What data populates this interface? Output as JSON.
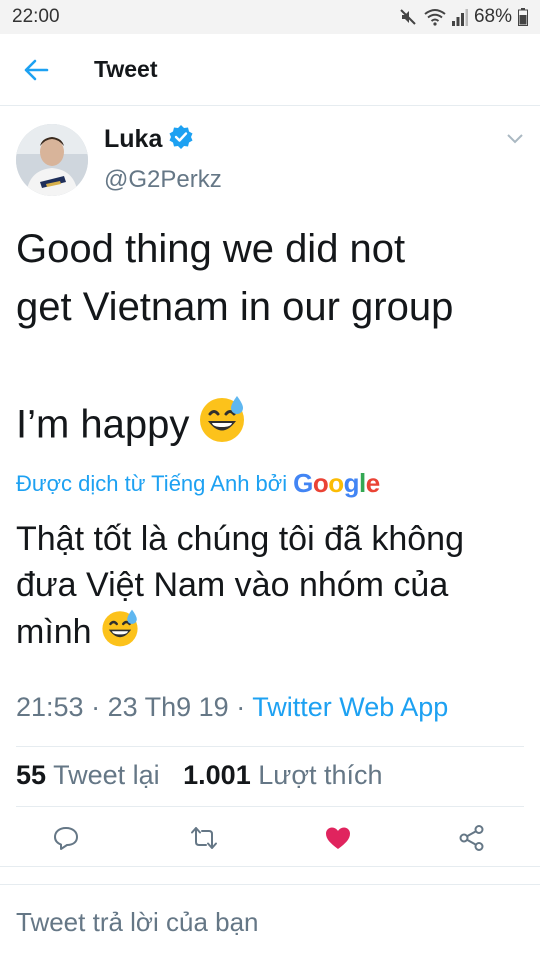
{
  "status_bar": {
    "time": "22:00",
    "battery": "68%",
    "icons": [
      "mute-icon",
      "wifi-icon",
      "signal-icon",
      "battery-icon"
    ]
  },
  "header": {
    "title": "Tweet",
    "back_icon": "back-arrow-icon"
  },
  "tweet": {
    "author_name": "Luka",
    "verified": true,
    "handle": "@G2Perkz",
    "text_lines": [
      "Good thing we did not",
      "get Vietnam in our group",
      "",
      "I’m happy"
    ],
    "emoji": "sweat-smile-emoji",
    "translated_by": "Được dịch từ Tiếng Anh bởi",
    "translator_brand": "Google",
    "translation_lines": [
      "Thật tốt là chúng tôi đã không",
      "đưa Việt Nam vào nhóm của",
      "mình"
    ],
    "time": "21:53",
    "date": "23 Th9 19",
    "source": "Twitter Web App",
    "retweet_count": "55",
    "retweet_label": "Tweet lại",
    "like_count": "1.001",
    "like_label": "Lượt thích",
    "liked": true
  },
  "actions": [
    "reply-icon",
    "retweet-icon",
    "like-icon",
    "share-icon"
  ],
  "reply": {
    "placeholder": "Tweet trả lời của bạn"
  },
  "colors": {
    "accent": "#1da1f2",
    "like": "#e0245e",
    "secondary_text": "#657786",
    "verified": "#1da1f2"
  }
}
